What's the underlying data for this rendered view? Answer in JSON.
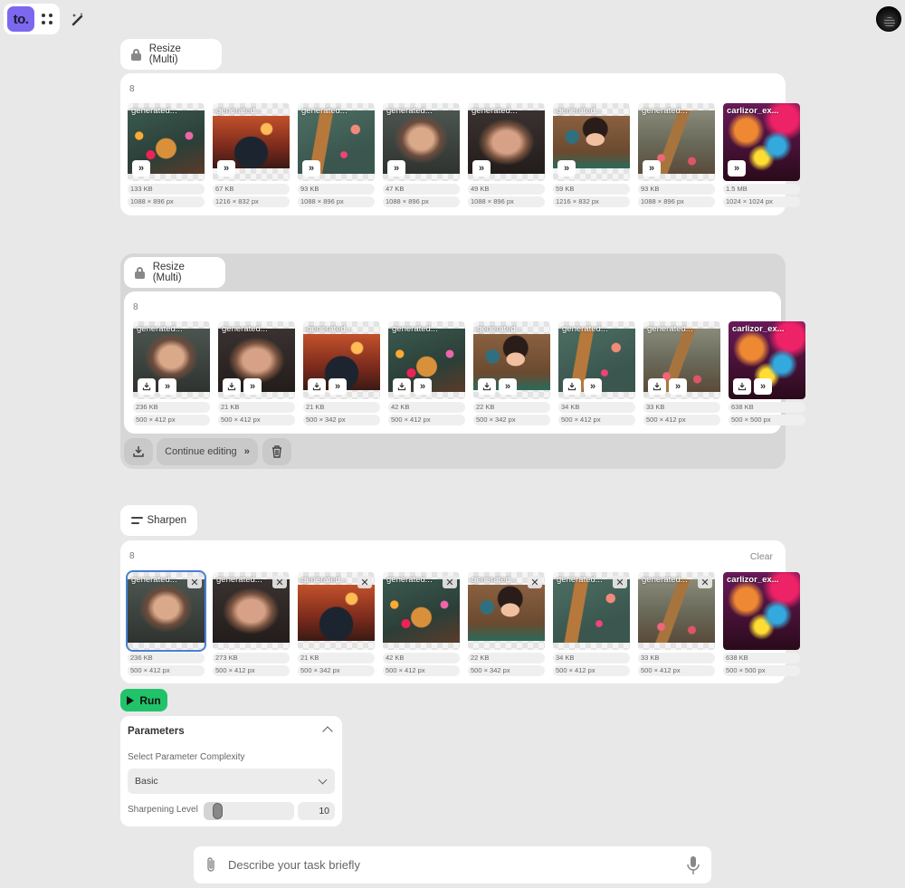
{
  "app": {
    "logo_text": "to.",
    "icons": {
      "apps": "apps-grid-icon",
      "wand": "magic-wand-icon",
      "avatar": "user-avatar"
    }
  },
  "sections": [
    {
      "tool_name": "Resize (Multi)",
      "tool_icon": "lock-icon",
      "count": "8",
      "items": [
        {
          "name": "generated...",
          "size": "133 KB",
          "dims": "1088 × 896 px",
          "image": "giraffe1"
        },
        {
          "name": "generated...",
          "size": "67 KB",
          "dims": "1216 × 832 px",
          "image": "cat"
        },
        {
          "name": "generated...",
          "size": "93 KB",
          "dims": "1088 × 896 px",
          "image": "giraffe2"
        },
        {
          "name": "generated...",
          "size": "47 KB",
          "dims": "1088 × 896 px",
          "image": "woman1"
        },
        {
          "name": "generated...",
          "size": "49 KB",
          "dims": "1088 × 896 px",
          "image": "woman2"
        },
        {
          "name": "generated...",
          "size": "59 KB",
          "dims": "1216 × 832 px",
          "image": "anime"
        },
        {
          "name": "generated...",
          "size": "93 KB",
          "dims": "1088 × 896 px",
          "image": "giraffe3"
        },
        {
          "name": "carlizor_ex...",
          "size": "1.5 MB",
          "dims": "1024 × 1024 px",
          "image": "colorful"
        }
      ]
    },
    {
      "tool_name": "Resize (Multi)",
      "tool_icon": "lock-icon",
      "count": "8",
      "items": [
        {
          "name": "generated...",
          "size": "236 KB",
          "dims": "500 × 412 px",
          "image": "woman1"
        },
        {
          "name": "generated...",
          "size": "21 KB",
          "dims": "500 × 412 px",
          "image": "woman2"
        },
        {
          "name": "generated...",
          "size": "21 KB",
          "dims": "500 × 342 px",
          "image": "cat"
        },
        {
          "name": "generated...",
          "size": "42 KB",
          "dims": "500 × 412 px",
          "image": "giraffe1"
        },
        {
          "name": "generated...",
          "size": "22 KB",
          "dims": "500 × 342 px",
          "image": "anime"
        },
        {
          "name": "generated...",
          "size": "34 KB",
          "dims": "500 × 412 px",
          "image": "giraffe2"
        },
        {
          "name": "generated...",
          "size": "33 KB",
          "dims": "500 × 412 px",
          "image": "giraffe3"
        },
        {
          "name": "carlizor_ex...",
          "size": "638 KB",
          "dims": "500 × 500 px",
          "image": "colorful"
        }
      ],
      "actions": {
        "download": "download-icon",
        "continue_label": "Continue editing",
        "delete": "trash-icon"
      }
    },
    {
      "tool_name": "Sharpen",
      "tool_icon": "sharpen-icon",
      "count": "8",
      "clear_label": "Clear",
      "selected_index": 0,
      "items": [
        {
          "name": "generated...",
          "size": "236 KB",
          "dims": "500 × 412 px",
          "image": "woman1"
        },
        {
          "name": "generated...",
          "size": "273 KB",
          "dims": "500 × 412 px",
          "image": "woman2"
        },
        {
          "name": "generated...",
          "size": "21 KB",
          "dims": "500 × 342 px",
          "image": "cat"
        },
        {
          "name": "generated...",
          "size": "42 KB",
          "dims": "500 × 412 px",
          "image": "giraffe1"
        },
        {
          "name": "generated...",
          "size": "22 KB",
          "dims": "500 × 342 px",
          "image": "anime"
        },
        {
          "name": "generated...",
          "size": "34 KB",
          "dims": "500 × 412 px",
          "image": "giraffe2"
        },
        {
          "name": "generated...",
          "size": "33 KB",
          "dims": "500 × 412 px",
          "image": "giraffe3"
        },
        {
          "name": "carlizor_ex...",
          "size": "638 KB",
          "dims": "500 × 500 px",
          "image": "colorful"
        }
      ]
    }
  ],
  "run_label": "Run",
  "parameters": {
    "title": "Parameters",
    "complexity_label": "Select Parameter Complexity",
    "complexity_value": "Basic",
    "sharpening_label": "Sharpening Level",
    "sharpening_value": "10",
    "sharpening_fraction": 0.1
  },
  "chat": {
    "placeholder": "Describe your task briefly"
  }
}
